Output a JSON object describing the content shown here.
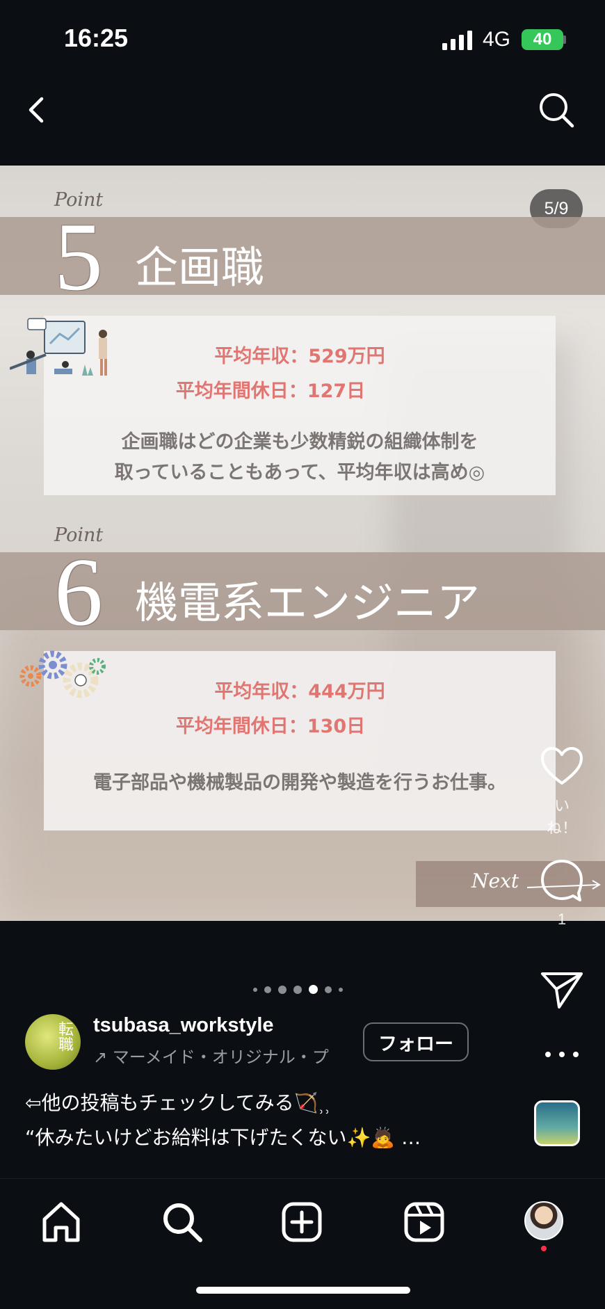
{
  "status_bar": {
    "time": "16:25",
    "network": "4G",
    "battery": "40"
  },
  "slide": {
    "counter": "5/9",
    "sections": [
      {
        "point_label": "Point",
        "number": "5",
        "title": "企画職",
        "salary": "平均年収：529万円",
        "holidays": "平均年間休日：127日",
        "desc_line1": "企画職はどの企業も少数精鋭の組織体制を",
        "desc_line2": "取っていることもあって、平均年収は高め◎"
      },
      {
        "point_label": "Point",
        "number": "6",
        "title": "機電系エンジニア",
        "salary": "平均年収：444万円",
        "holidays": "平均年間休日：130日",
        "desc_line1": "電子部品や機械製品の開発や製造を行うお仕事。"
      }
    ],
    "next_label": "Next"
  },
  "rail": {
    "like_label": "いね！",
    "comment_count": "1"
  },
  "post": {
    "username": "tsubasa_workstyle",
    "avatar_text": "転職",
    "music": "マーメイド・オリジナル・プ",
    "follow_label": "フォロー",
    "caption_line1": "⇦他の投稿もチェックしてみる🏹⸒⸒",
    "caption_line2": "“休みたいけどお給料は下げたくない✨🙇 …"
  },
  "icons": {
    "back": "back-arrow-icon",
    "search": "search-icon",
    "heart": "heart-icon",
    "comment": "comment-icon",
    "share": "paper-plane-icon",
    "more": "more-dots-icon",
    "home": "home-icon",
    "create": "plus-square-icon",
    "reels": "reels-icon"
  },
  "colors": {
    "background": "#0b0e12",
    "band": "#ac9b92",
    "salary_text": "#e07672",
    "desc_text": "#7b7674",
    "battery": "#35c759"
  }
}
